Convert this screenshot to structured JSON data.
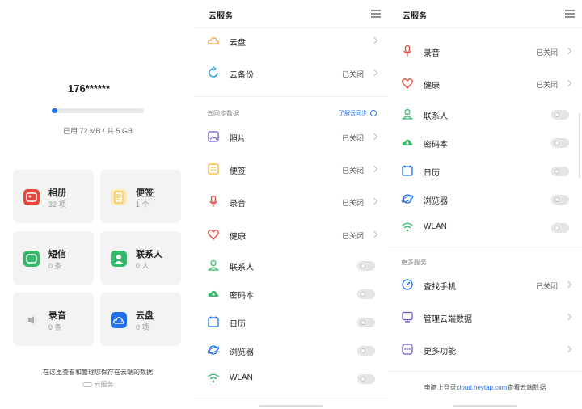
{
  "screen1": {
    "account": "176******",
    "quota_fraction": 0.014,
    "quota_text": "已用 72 MB / 共 5 GB",
    "tiles": [
      {
        "title": "相册",
        "count": "32 项",
        "icon": "photo-album-icon",
        "color": "#e8453c"
      },
      {
        "title": "便签",
        "count": "1 个",
        "icon": "notes-icon",
        "color": "#f3c64a"
      },
      {
        "title": "短信",
        "count": "0 条",
        "icon": "messages-icon",
        "color": "#35b86a"
      },
      {
        "title": "联系人",
        "count": "0 人",
        "icon": "contacts-icon",
        "color": "#35b86a"
      },
      {
        "title": "录音",
        "count": "0 条",
        "icon": "recorder-icon",
        "color": "#bbbbbb"
      },
      {
        "title": "云盘",
        "count": "0 项",
        "icon": "cloud-drive-icon",
        "color": "#1f6feb"
      }
    ],
    "footer": "在这里查看和管理您保存在云端的数据",
    "brand": "云服务"
  },
  "screen2": {
    "title": "云服务",
    "top_rows": [
      {
        "label": "云盘",
        "status": "",
        "icon": "cloud-drive-icon",
        "color": "#f0a23a"
      },
      {
        "label": "云备份",
        "status": "已关闭",
        "icon": "cloud-backup-icon",
        "color": "#1aa3d9"
      }
    ],
    "sync_section": "云同步数据",
    "sync_link": "了解云同步",
    "sync_rows": [
      {
        "label": "照片",
        "status": "已关闭",
        "icon": "photo-icon",
        "color": "#6a5acd"
      },
      {
        "label": "便签",
        "status": "已关闭",
        "icon": "notes-icon",
        "color": "#f0b429"
      },
      {
        "label": "录音",
        "status": "已关闭",
        "icon": "microphone-icon",
        "color": "#e8453c"
      },
      {
        "label": "健康",
        "status": "已关闭",
        "icon": "heart-icon",
        "color": "#e8453c"
      }
    ],
    "toggle_rows": [
      {
        "label": "联系人",
        "icon": "contact-icon",
        "color": "#35b86a"
      },
      {
        "label": "密码本",
        "icon": "cloud-key-icon",
        "color": "#35b86a"
      },
      {
        "label": "日历",
        "icon": "calendar-icon",
        "color": "#1f6feb"
      },
      {
        "label": "浏览器",
        "icon": "browser-icon",
        "color": "#1f6feb"
      },
      {
        "label": "WLAN",
        "icon": "wifi-icon",
        "color": "#35b86a"
      }
    ]
  },
  "screen3": {
    "title": "云服务",
    "status_rows": [
      {
        "label": "录音",
        "status": "已关闭",
        "icon": "microphone-icon",
        "color": "#e8453c"
      },
      {
        "label": "健康",
        "status": "已关闭",
        "icon": "heart-icon",
        "color": "#e8453c"
      }
    ],
    "toggle_rows": [
      {
        "label": "联系人",
        "icon": "contact-icon",
        "color": "#35b86a"
      },
      {
        "label": "密码本",
        "icon": "cloud-key-icon",
        "color": "#35b86a"
      },
      {
        "label": "日历",
        "icon": "calendar-icon",
        "color": "#1f6feb"
      },
      {
        "label": "浏览器",
        "icon": "browser-icon",
        "color": "#1f6feb"
      },
      {
        "label": "WLAN",
        "icon": "wifi-icon",
        "color": "#35b86a"
      }
    ],
    "more_section": "更多服务",
    "more_rows": [
      {
        "label": "查找手机",
        "status": "已关闭",
        "icon": "find-phone-icon",
        "color": "#1f6feb"
      },
      {
        "label": "管理云端数据",
        "status": "",
        "icon": "manage-data-icon",
        "color": "#6a5acd"
      },
      {
        "label": "更多功能",
        "status": "",
        "icon": "more-features-icon",
        "color": "#6a5acd"
      }
    ],
    "footer_pre": "电脑上登录",
    "footer_link": "cloud.heytap.com",
    "footer_post": "查看云端数据"
  }
}
